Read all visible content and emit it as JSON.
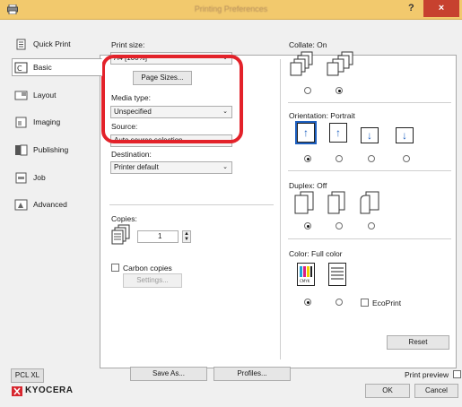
{
  "window": {
    "title": "Printing Preferences",
    "help": "?",
    "close": "×"
  },
  "sidebar": {
    "items": [
      {
        "label": "Quick Print",
        "icon": "quick-print-icon"
      },
      {
        "label": "Basic",
        "icon": "basic-icon"
      },
      {
        "label": "Layout",
        "icon": "layout-icon"
      },
      {
        "label": "Imaging",
        "icon": "imaging-icon"
      },
      {
        "label": "Publishing",
        "icon": "publishing-icon"
      },
      {
        "label": "Job",
        "icon": "job-icon"
      },
      {
        "label": "Advanced",
        "icon": "advanced-icon"
      }
    ],
    "selected": "Basic"
  },
  "basic": {
    "print_size_label": "Print size:",
    "print_size_value": "A4 [100%]",
    "page_sizes_button": "Page Sizes...",
    "media_type_label": "Media type:",
    "media_type_value": "Unspecified",
    "source_label": "Source:",
    "source_value": "Auto source selection",
    "destination_label": "Destination:",
    "destination_value": "Printer default",
    "copies_label": "Copies:",
    "copies_value": "1",
    "carbon_copies_label": "Carbon copies",
    "carbon_settings_button": "Settings..."
  },
  "right": {
    "collate_label": "Collate:  On",
    "orientation_label": "Orientation:  Portrait",
    "duplex_label": "Duplex:  Off",
    "color_label": "Color:  Full color",
    "ecoprint_label": "EcoPrint",
    "reset_button": "Reset",
    "collate_selected_index": 1,
    "orientation_selected_index": 0,
    "duplex_selected_index": 0,
    "color_selected_index": 0
  },
  "footer": {
    "pcl_button": "PCL XL",
    "save_as_button": "Save As...",
    "profiles_button": "Profiles...",
    "print_preview_label": "Print preview",
    "brand": "KYOCERA",
    "ok_button": "OK",
    "cancel_button": "Cancel"
  },
  "colors": {
    "titlebar": "#f2c96d",
    "close": "#c7412f",
    "highlight": "#e3222a",
    "brand": "#d7262e"
  }
}
